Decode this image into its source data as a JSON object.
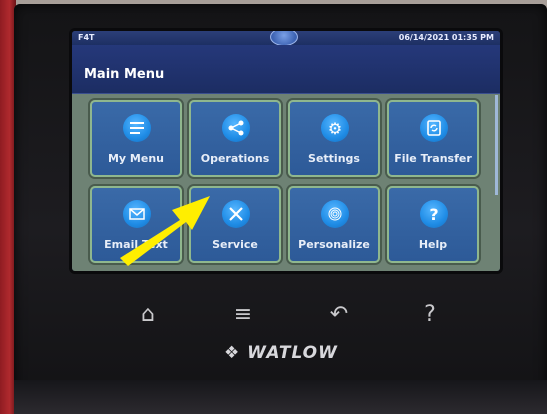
{
  "statusbar": {
    "left_label": "F4T",
    "datetime": "06/14/2021 01:35 PM"
  },
  "header": {
    "title": "Main Menu"
  },
  "tiles": [
    {
      "label": "My Menu",
      "icon": "list-icon"
    },
    {
      "label": "Operations",
      "icon": "share-nodes-icon"
    },
    {
      "label": "Settings",
      "icon": "gears-icon"
    },
    {
      "label": "File Transfer",
      "icon": "file-sync-icon"
    },
    {
      "label": "Email Text",
      "icon": "envelope-icon"
    },
    {
      "label": "Service",
      "icon": "tools-icon"
    },
    {
      "label": "Personalize",
      "icon": "fingerprint-icon"
    },
    {
      "label": "Help",
      "icon": "question-icon"
    }
  ],
  "hardware_buttons": [
    {
      "name": "home-icon"
    },
    {
      "name": "menu-icon"
    },
    {
      "name": "back-icon"
    },
    {
      "name": "help-icon"
    }
  ],
  "brand": {
    "logo_text": "WATLOW"
  },
  "colors": {
    "screen_bg": "#1b2e60",
    "tile_bg": "#2d5a98",
    "tile_border": "#8fb78e",
    "icon_blue": "#1f8ce6",
    "annotation_arrow": "#ffee00"
  }
}
